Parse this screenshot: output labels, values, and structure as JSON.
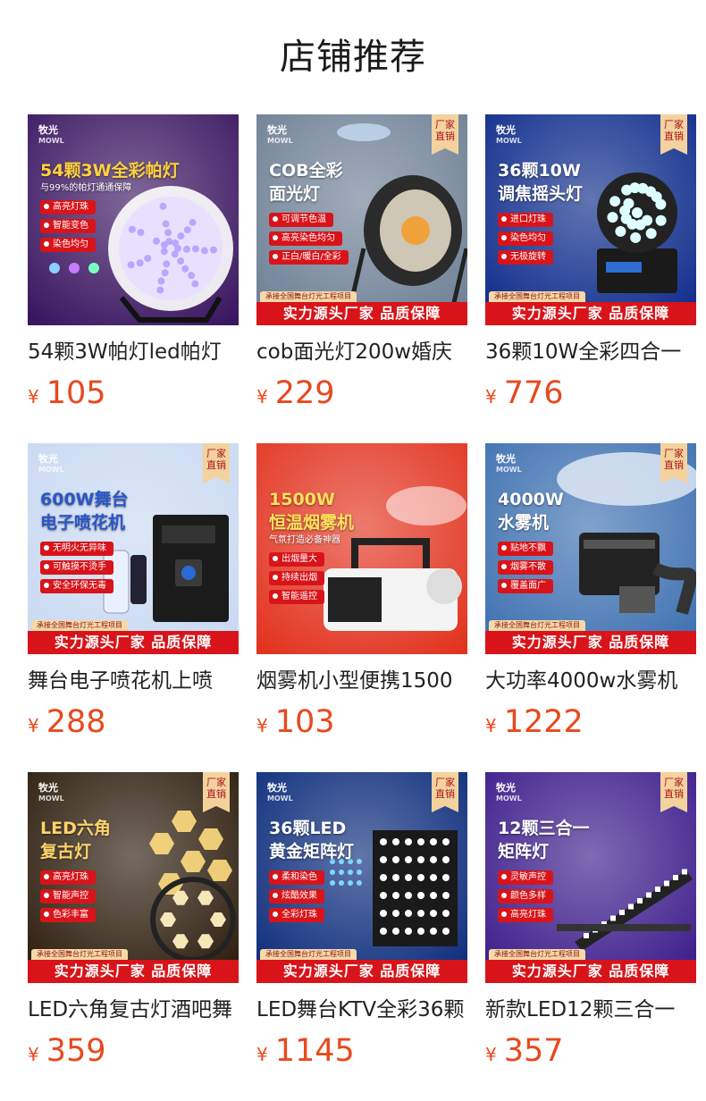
{
  "page": {
    "title": "店铺推荐"
  },
  "products": [
    {
      "name": "54颗3W帕灯led帕灯",
      "currency": "¥",
      "price": "105",
      "image": {
        "brand": "牧光",
        "brand_en": "MOWL",
        "headline": [
          "54颗3W全彩帕灯"
        ],
        "subline": "与99%的帕灯通通保障",
        "features": [
          "高亮灯珠",
          "智能变色",
          "染色均匀"
        ],
        "badge": "",
        "banner": "",
        "banner_tag": "",
        "bg": "#3a1560",
        "accent": "#ffd23a"
      }
    },
    {
      "name": "cob面光灯200w婚庆",
      "currency": "¥",
      "price": "229",
      "image": {
        "brand": "牧光",
        "brand_en": "MOWL",
        "headline": [
          "COB全彩",
          "面光灯"
        ],
        "subline": "",
        "features": [
          "可调节色温",
          "高亮染色均匀",
          "正白/暖白/全彩"
        ],
        "badge": "厂家直销",
        "banner": "实力源头厂家 品质保障",
        "banner_tag": "承接全国舞台灯光工程项目",
        "bg": "#6d7f95",
        "accent": "#ffffff"
      }
    },
    {
      "name": "36颗10W全彩四合一",
      "currency": "¥",
      "price": "776",
      "image": {
        "brand": "牧光",
        "brand_en": "MOWL",
        "headline": [
          "36颗10W",
          "调焦摇头灯"
        ],
        "subline": "",
        "features": [
          "进口灯珠",
          "染色均匀",
          "无极旋转"
        ],
        "badge": "厂家直销",
        "banner": "实力源头厂家 品质保障",
        "banner_tag": "承接全国舞台灯光工程项目",
        "bg": "#0c2a8a",
        "accent": "#ffffff"
      }
    },
    {
      "name": "舞台电子喷花机上喷",
      "currency": "¥",
      "price": "288",
      "image": {
        "brand": "牧光",
        "brand_en": "MOWL",
        "headline": [
          "600W舞台",
          "电子喷花机"
        ],
        "subline": "",
        "features": [
          "无明火无异味",
          "可触摸不烫手",
          "安全环保无毒"
        ],
        "badge": "厂家直销",
        "banner": "实力源头厂家 品质保障",
        "banner_tag": "承接全国舞台灯光工程项目",
        "bg": "#c9d9f2",
        "accent": "#2a56c8"
      }
    },
    {
      "name": "烟雾机小型便携1500",
      "currency": "¥",
      "price": "103",
      "image": {
        "brand": "",
        "brand_en": "",
        "headline": [
          "1500W",
          "恒温烟雾机"
        ],
        "subline": "气氛打造必备神器",
        "features": [
          "出烟量大",
          "持续出烟",
          "智能遥控"
        ],
        "badge": "",
        "banner": "",
        "banner_tag": "",
        "bg": "#e2331f",
        "accent": "#ffe15a"
      }
    },
    {
      "name": "大功率4000w水雾机",
      "currency": "¥",
      "price": "1222",
      "image": {
        "brand": "牧光",
        "brand_en": "MOWL",
        "headline": [
          "4000W",
          "水雾机"
        ],
        "subline": "",
        "features": [
          "贴地不飘",
          "烟雾不散",
          "覆盖面广"
        ],
        "badge": "厂家直销",
        "banner": "实力源头厂家 品质保障",
        "banner_tag": "承接全国舞台灯光工程项目",
        "bg": "#3c6fb0",
        "accent": "#ffffff"
      }
    },
    {
      "name": "LED六角复古灯酒吧舞",
      "currency": "¥",
      "price": "359",
      "image": {
        "brand": "牧光",
        "brand_en": "MOWL",
        "headline": [
          "LED六角",
          "复古灯"
        ],
        "subline": "",
        "features": [
          "高亮灯珠",
          "智能声控",
          "色彩丰富"
        ],
        "badge": "厂家直销",
        "banner": "实力源头厂家 品质保障",
        "banner_tag": "承接全国舞台灯光工程项目",
        "bg": "#2a1a0a",
        "accent": "#ffd36b"
      }
    },
    {
      "name": "LED舞台KTV全彩36颗",
      "currency": "¥",
      "price": "1145",
      "image": {
        "brand": "牧光",
        "brand_en": "MOWL",
        "headline": [
          "36颗LED",
          "黄金矩阵灯"
        ],
        "subline": "",
        "features": [
          "柔和染色",
          "炫酷效果",
          "全彩灯珠"
        ],
        "badge": "厂家直销",
        "banner": "实力源头厂家 品质保障",
        "banner_tag": "承接全国舞台灯光工程项目",
        "bg": "#0a2a7a",
        "accent": "#ffffff"
      }
    },
    {
      "name": "新款LED12颗三合一",
      "currency": "¥",
      "price": "357",
      "image": {
        "brand": "牧光",
        "brand_en": "MOWL",
        "headline": [
          "12颗三合一",
          "矩阵灯"
        ],
        "subline": "",
        "features": [
          "灵敏声控",
          "颜色多样",
          "高亮灯珠"
        ],
        "badge": "厂家直销",
        "banner": "实力源头厂家 品质保障",
        "banner_tag": "承接全国舞台灯光工程项目",
        "bg": "#3a1a8a",
        "accent": "#ffffff"
      }
    }
  ]
}
